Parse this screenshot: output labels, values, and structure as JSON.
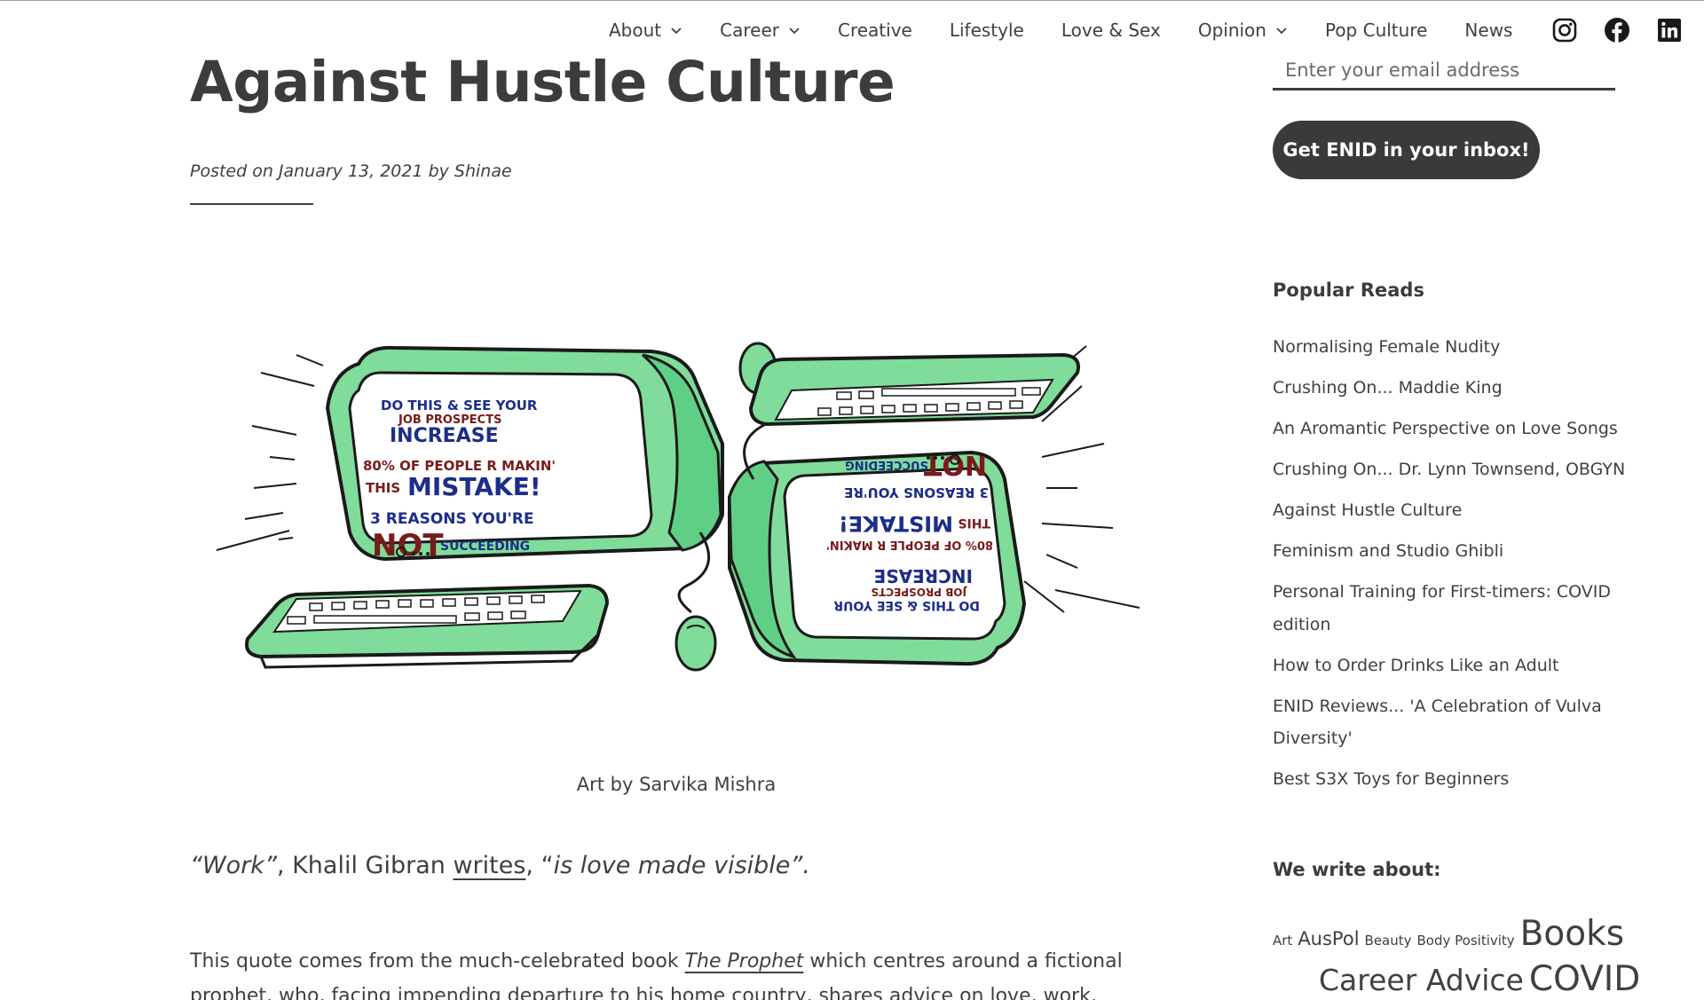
{
  "nav": {
    "items": [
      {
        "label": "About",
        "dropdown": true
      },
      {
        "label": "Career",
        "dropdown": true
      },
      {
        "label": "Creative",
        "dropdown": false
      },
      {
        "label": "Lifestyle",
        "dropdown": false
      },
      {
        "label": "Love & Sex",
        "dropdown": false
      },
      {
        "label": "Opinion",
        "dropdown": true
      },
      {
        "label": "Pop Culture",
        "dropdown": false
      },
      {
        "label": "News",
        "dropdown": false
      }
    ],
    "social_icons": [
      "instagram-icon",
      "facebook-icon",
      "linkedin-icon"
    ]
  },
  "article": {
    "title": "Against Hustle Culture",
    "posted_on": "Posted on",
    "date": "January 13, 2021",
    "by": "by",
    "author": "Shinae",
    "figure_caption": "Art by Sarvika Mishra",
    "quote": {
      "part1": "“Work”",
      "part2": ", Khalil Gibran ",
      "link": "writes",
      "part3": ", “",
      "part4": "is love made visible",
      "part5": "”."
    },
    "para1": {
      "before": "This quote comes from the much-celebrated book ",
      "link": "The Prophet",
      "after": " which centres around a fictional prophet, who, facing impending departure to his home country, shares advice on love, work, marriage, parenting"
    }
  },
  "illustration": {
    "screen_line1": "DO THIS & SEE YOUR",
    "screen_line2": "JOB PROSPECTS",
    "screen_line3": "INCREASE",
    "screen_line4": "80% OF PEOPLE R MAKIN'",
    "screen_line5": "THIS",
    "screen_line6": "MISTAKE!",
    "screen_line7": "3 REASONS YOU'RE",
    "screen_line8": "NOT",
    "screen_line9": "SUCCEEDING"
  },
  "sidebar": {
    "email_placeholder": "Enter your email address",
    "cta_label": "Get ENID in your inbox!",
    "popular_heading": "Popular Reads",
    "popular": [
      "Normalising Female Nudity",
      "Crushing On... Maddie King",
      "An Aromantic Perspective on Love Songs",
      "Crushing On... Dr. Lynn Townsend, OBGYN",
      "Against Hustle Culture",
      "Feminism and Studio Ghibli",
      "Personal Training for First-timers: COVID edition",
      "How to Order Drinks Like an Adult",
      "ENID Reviews... 'A Celebration of Vulva Diversity'",
      "Best S3X Toys for Beginners"
    ],
    "topics_heading": "We write about:",
    "tags": [
      {
        "label": "Art",
        "weight": 1
      },
      {
        "label": "AusPol",
        "weight": 2
      },
      {
        "label": "Beauty",
        "weight": 1
      },
      {
        "label": "Body Positivity",
        "weight": 1
      },
      {
        "label": "Books",
        "weight": 4
      },
      {
        "label": "Career Advice",
        "weight": 3
      },
      {
        "label": "COVID",
        "weight": 4
      }
    ]
  },
  "colors": {
    "text": "#404040",
    "button_bg": "#3a3a3a",
    "monitor_green": "#7fdc9a",
    "ink_blue": "#1c2d8a",
    "ink_red": "#7a1a1a"
  }
}
